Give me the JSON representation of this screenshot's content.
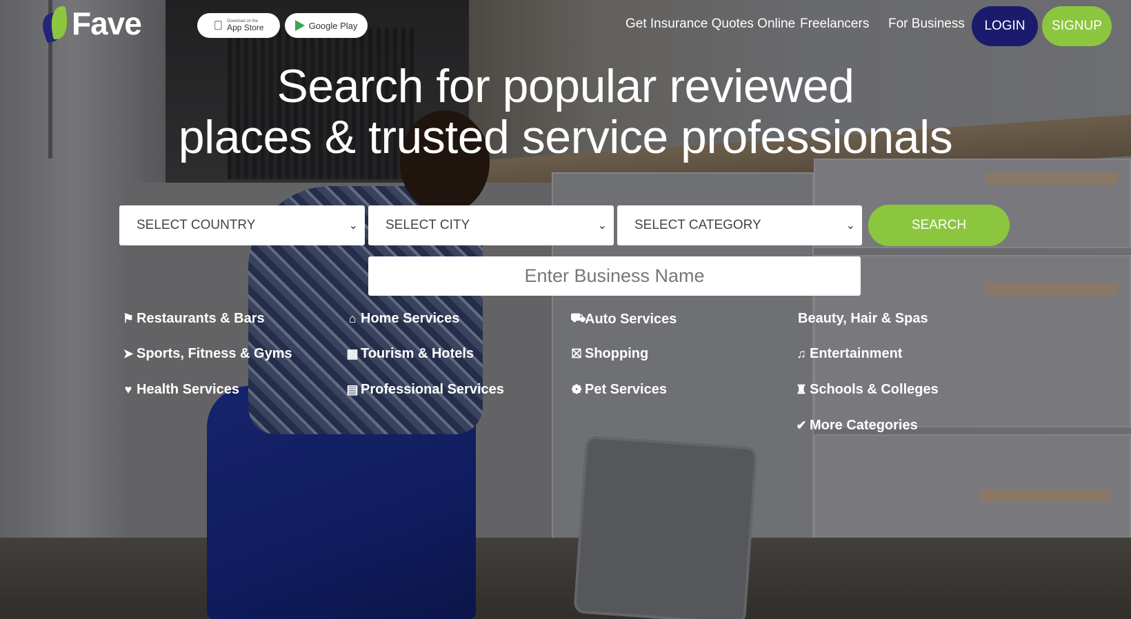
{
  "brand": {
    "name": "Fave"
  },
  "app_badges": {
    "apple_small": "Download on the",
    "apple_big": "App Store",
    "google": "Google Play"
  },
  "nav": {
    "insurance": "Get Insurance Quotes Online",
    "freelancers": "Freelancers",
    "business": "For Business",
    "login": "LOGIN",
    "signup": "SIGNUP"
  },
  "hero": {
    "line1": "Search for popular reviewed",
    "line2": "places & trusted service professionals"
  },
  "search": {
    "country": "SELECT COUNTRY",
    "city": "SELECT CITY",
    "category": "SELECT CATEGORY",
    "button": "SEARCH",
    "business_placeholder": "Enter Business Name"
  },
  "categories": {
    "restaurants": "Restaurants & Bars",
    "home": "Home Services",
    "auto": "Auto Services",
    "beauty": "Beauty, Hair & Spas",
    "sports": "Sports, Fitness & Gyms",
    "tourism": "Tourism & Hotels",
    "shopping": "Shopping",
    "entertainment": "Entertainment",
    "health": "Health Services",
    "professional": "Professional Services",
    "pet": "Pet Services",
    "schools": "Schools & Colleges",
    "more": "More Categories"
  },
  "colors": {
    "accent_green": "#8cc63f",
    "brand_navy": "#1b1b6e"
  }
}
